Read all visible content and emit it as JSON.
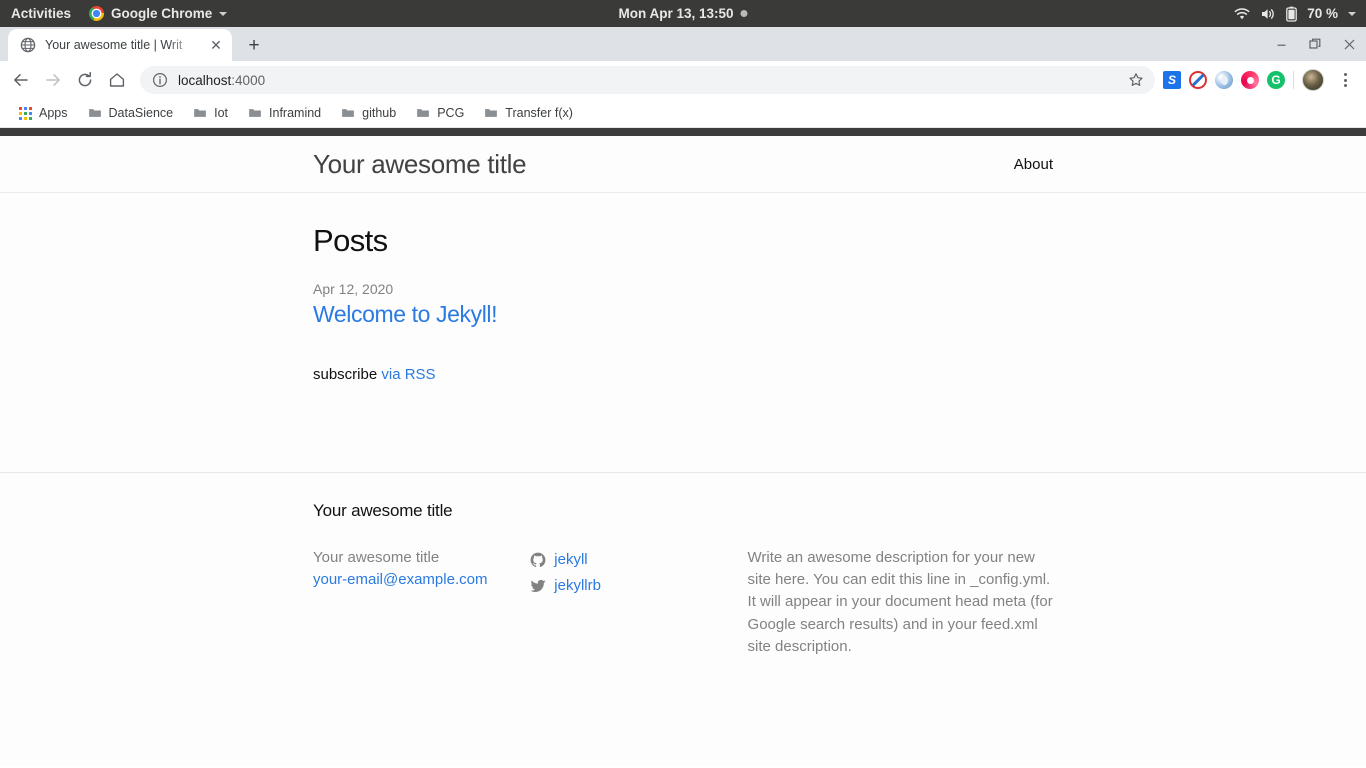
{
  "desktop": {
    "activities_label": "Activities",
    "app_name": "Google Chrome",
    "clock": "Mon Apr 13, 13:50",
    "battery_pct": "70 %",
    "icons": {
      "chrome": "chrome-logo-icon",
      "app_menu_caret": "caret-down-icon",
      "notification": "notification-dot-icon",
      "wifi": "wifi-icon",
      "volume": "volume-icon",
      "battery": "battery-icon",
      "system_caret": "caret-down-icon"
    }
  },
  "browser": {
    "tab": {
      "title": "Your awesome title | Writ",
      "favicon": "globe-icon",
      "close_icon": "close-icon"
    },
    "new_tab_label": "+",
    "window_controls": {
      "minimize": "minimize-icon",
      "restore": "restore-icon",
      "close": "close-icon"
    },
    "toolbar": {
      "back_icon": "back-arrow-icon",
      "forward_icon": "forward-arrow-icon",
      "reload_icon": "reload-icon",
      "home_icon": "home-icon",
      "site_info_icon": "info-circle-icon",
      "url_host": "localhost",
      "url_port": ":4000",
      "url_full": "localhost:4000",
      "bookmark_star_icon": "star-icon",
      "menu_icon": "kebab-menu-icon",
      "avatar": "profile-avatar-icon",
      "extensions": [
        {
          "name": "scribd-extension-icon",
          "label": "S"
        },
        {
          "name": "adblock-extension-icon",
          "label": ""
        },
        {
          "name": "drop-extension-icon",
          "label": ""
        },
        {
          "name": "spiral-extension-icon",
          "label": ""
        },
        {
          "name": "grammarly-extension-icon",
          "label": "G"
        }
      ]
    },
    "bookmarks": [
      {
        "label": "Apps",
        "icon": "apps-grid-icon"
      },
      {
        "label": "DataSience",
        "icon": "folder-icon"
      },
      {
        "label": "Iot",
        "icon": "folder-icon"
      },
      {
        "label": "Inframind",
        "icon": "folder-icon"
      },
      {
        "label": "github",
        "icon": "folder-icon"
      },
      {
        "label": "PCG",
        "icon": "folder-icon"
      },
      {
        "label": "Transfer f(x)",
        "icon": "folder-icon"
      }
    ]
  },
  "site": {
    "header": {
      "title": "Your awesome title",
      "nav": [
        {
          "label": "About"
        }
      ]
    },
    "main": {
      "heading": "Posts",
      "posts": [
        {
          "date": "Apr 12, 2020",
          "title": "Welcome to Jekyll!"
        }
      ],
      "subscribe_text": "subscribe ",
      "subscribe_link": "via RSS"
    },
    "footer": {
      "heading": "Your awesome title",
      "contact": {
        "name": "Your awesome title",
        "email": "your-email@example.com"
      },
      "social": [
        {
          "icon": "github-icon",
          "label": "jekyll"
        },
        {
          "icon": "twitter-icon",
          "label": "jekyllrb"
        }
      ],
      "description": "Write an awesome description for your new site here. You can edit this line in _config.yml. It will appear in your document head meta (for Google search results) and in your feed.xml site description."
    }
  },
  "colors": {
    "link": "#2a7ae2",
    "muted": "#828282",
    "gnome_bar": "#3a3a38",
    "page_topbar": "#3c3c3c"
  }
}
